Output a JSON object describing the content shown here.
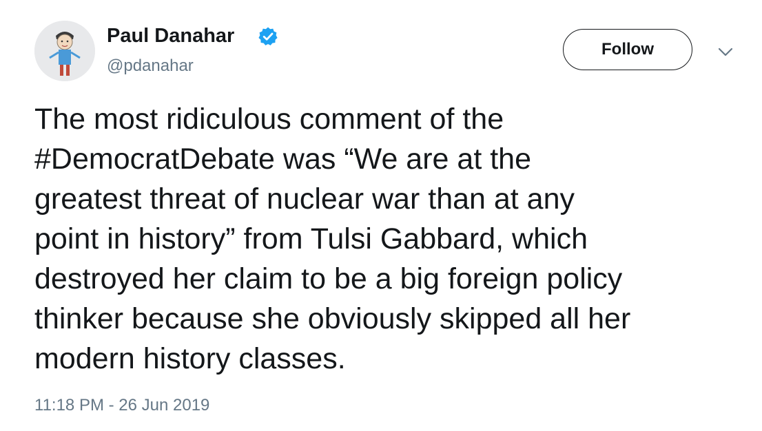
{
  "author": {
    "display_name": "Paul Danahar",
    "handle": "@pdanahar",
    "verified": true,
    "avatar_icon": "child-drawing-avatar"
  },
  "actions": {
    "follow_label": "Follow",
    "more_icon": "chevron-down-icon"
  },
  "tweet": {
    "text_lines": [
      "The most ridiculous comment of the",
      "#DemocratDebate was “We are at the",
      "greatest threat of nuclear war than at any",
      "point in history” from Tulsi Gabbard, which",
      "destroyed her claim to be a big foreign policy",
      "thinker because she obviously skipped all her",
      "modern history classes."
    ],
    "timestamp": "11:18 PM - 26 Jun 2019"
  },
  "colors": {
    "text_primary": "#14171a",
    "text_secondary": "#657786",
    "verified_blue": "#1da1f2",
    "background": "#ffffff"
  }
}
